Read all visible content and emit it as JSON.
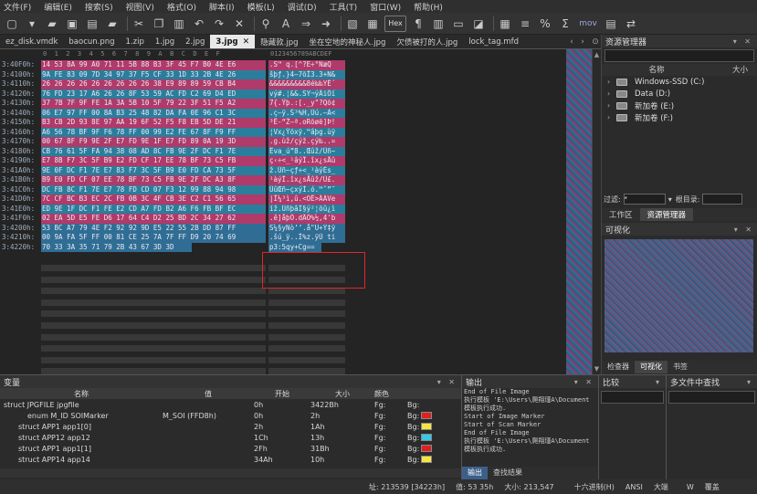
{
  "menu": [
    "文件(F)",
    "编辑(E)",
    "搜索(S)",
    "视图(V)",
    "格式(O)",
    "脚本(I)",
    "模板(L)",
    "调试(D)",
    "工具(T)",
    "窗口(W)",
    "帮助(H)"
  ],
  "toolbar": {
    "hex_label": "Hex",
    "mov_label": "mov"
  },
  "tabs": [
    {
      "label": "ez_disk.vmdk",
      "active": false
    },
    {
      "label": "baocun.png",
      "active": false
    },
    {
      "label": "1.zip",
      "active": false
    },
    {
      "label": "1.jpg",
      "active": false
    },
    {
      "label": "2.jpg",
      "active": false
    },
    {
      "label": "3.jpg",
      "active": true
    },
    {
      "label": "隐藏款.jpg",
      "active": false
    },
    {
      "label": "坐在空地的神秘人.jpg",
      "active": false
    },
    {
      "label": "欠债被打的人.jpg",
      "active": false
    },
    {
      "label": "lock_tag.mfd",
      "active": false
    }
  ],
  "ruler": {
    "hex": "0  1  2  3  4  5  6  7  8  9  A  B  C  D  E  F",
    "text": "0123456789ABCDEF"
  },
  "hex_rows": [
    {
      "addr": "3:40F0h:",
      "hex": "14 53 8A 99 A0 71 11 5B 88 B3 3F 45 F7 B0 4E E6",
      "text": ".S™ q.[^?E÷°NæQ"
    },
    {
      "addr": "3:4100h:",
      "hex": "9A FE 83 09 7D 34 97 37 F5 CF 33 1D 33 2B 4E 26",
      "text": "šþƒ.}4—7õÏ3.3+N&"
    },
    {
      "addr": "3:4110h:",
      "hex": "26 26 26 26 26 26 26 26 26 38 E9 89 89 59 CB B4",
      "text": "&&&&&&&&&8é‰‰YË´"
    },
    {
      "addr": "3:4120h:",
      "hex": "76 FD 23 17 A6 26 26 8F 53 59 AC FD C2 69 D4 ED",
      "text": "vý#.¦&&.SY¬ýÂiÔí"
    },
    {
      "addr": "3:4130h:",
      "hex": "37 7B 7F 9F FE 1A 3A 5B 10 5F 79 22 3F 51 F5 A2",
      "text": "7{.Ÿþ.:[._y\"?Qõ¢"
    },
    {
      "addr": "3:4140h:",
      "hex": "06 E7 97 FF 00 8A B3 25 48 82 DA FA 0E 96 C1 3C",
      "text": ".ç—ÿ.Š³%H‚Úú.–Á<"
    },
    {
      "addr": "3:4150h:",
      "hex": "B3 CB 2D 93 8E 97 AA 19 6F 52 F5 F8 EB 5D DE 21",
      "text": "³Ë-“Ž—ª.oRõøë]Þ!"
    },
    {
      "addr": "3:4160h:",
      "hex": "A6 56 78 BF 9F F6 78 FF 00 99 E2 FE 67 8F F9 FF",
      "text": "¦Vx¿Ÿöxÿ.™âþg.ùÿ"
    },
    {
      "addr": "3:4170h:",
      "hex": "00 67 8F F9 9E 2F E7 FD 9E 1F E7 FD 89 0A 19 3D",
      "text": ".g.ùž/çýž.çý‰..="
    },
    {
      "addr": "3:4180h:",
      "hex": "CB 76 61 5F FA 94 38 08 AD 8C FB 9E 2F DC F1 7E",
      "text": "Ëva_ú”8..Œûž/Üñ~"
    },
    {
      "addr": "3:4190h:",
      "hex": "E7 8B F7 3C 5F B9 E2 FD CF 17 EE 78 BF 73 C5 FB",
      "text": "ç‹÷<_¹âýÏ.îx¿sÅû"
    },
    {
      "addr": "3:41A0h:",
      "hex": "9E 0F DC F1 7E E7 83 F7 3C 5F B9 E0 FD CA 73 5F",
      "text": "ž.Üñ~çƒ÷<_¹àýÊs_"
    },
    {
      "addr": "3:41B0h:",
      "hex": "B9 E0 FD CF 07 EE 78 BF 73 C5 FB 9E 2F DC A3 8F",
      "text": "¹àýÏ.îx¿sÅûž/Ü£."
    },
    {
      "addr": "3:41C0h:",
      "hex": "DC FB 8C F1 7E E7 78 FD CD 07 F3 12 99 88 94 98",
      "text": "ÜûŒñ~çxýÍ.ó.™ˆ”˜"
    },
    {
      "addr": "3:41D0h:",
      "hex": "7C CF BC B3 EC 2C FB 0B 3C 4F CB 3E C2 C1 56 65",
      "text": "|Ï¼³ì,û.<OË>ÂÁVe"
    },
    {
      "addr": "3:41E0h:",
      "hex": "ED 9E 1F DC F1 FE E2 CD A7 FD B2 A6 F6 FB BF EC",
      "text": "íž.ÜñþâÍ§ý²¦öû¿ì"
    },
    {
      "addr": "3:41F0h:",
      "hex": "02 EA 5D E5 FE D6 17 64 C4 D2 25 BD 2C 34 27 62",
      "text": ".ê]åþÖ.dÄÒ%½,4'b"
    },
    {
      "addr": "3:4200h:",
      "hex": "53 BC A7 79 4E F2 92 92 9D E5 22 55 2B DD 87 FF",
      "text": "S¼§yNò’’.å\"U+Ý‡ÿ"
    },
    {
      "addr": "3:4210h:",
      "hex": "00 9A FA 5F FF 00 81 CE 25 7A 7F FF D9 20 74 69",
      "text": ".šú_ÿ..Î%z.ÿÙ ti"
    },
    {
      "addr": "3:4220h:",
      "hex": "70 33 3A 35 71 79 2B 43 67 3D 3D",
      "text": "p3:5qy+Cg=="
    }
  ],
  "resource_manager": {
    "title": "资源管理器",
    "col_name": "名称",
    "col_size": "大小",
    "drives": [
      "Windows-SSD (C:)",
      "Data (D:)",
      "新加卷 (E:)",
      "新加卷 (F:)"
    ],
    "filter_label": "过滤:",
    "filter_value": "*",
    "root_label": "根目录:"
  },
  "right_tabs": [
    "工作区",
    "资源管理器"
  ],
  "visual": {
    "title": "可视化",
    "tabs": [
      "检查器",
      "可视化",
      "书签"
    ]
  },
  "variables": {
    "title": "变量",
    "headers": [
      "名称",
      "值",
      "开始",
      "大小",
      "颜色"
    ],
    "rows": [
      {
        "name": "struct JPGFILE jpgfile",
        "value": "",
        "start": "0h",
        "size": "3422Bh",
        "fg": "Fg:",
        "bg": "Bg:",
        "bgcolor": ""
      },
      {
        "name": "enum M_ID SOIMarker",
        "value": "M_SOI (FFD8h)",
        "start": "0h",
        "size": "2h",
        "fg": "Fg:",
        "bg": "Bg:",
        "bgcolor": "#e02020"
      },
      {
        "name": "struct APP1 app1[0]",
        "value": "",
        "start": "2h",
        "size": "1Ah",
        "fg": "Fg:",
        "bg": "Bg:",
        "bgcolor": "#f5e642"
      },
      {
        "name": "struct APP12 app12",
        "value": "",
        "start": "1Ch",
        "size": "13h",
        "fg": "Fg:",
        "bg": "Bg:",
        "bgcolor": "#35c8e8"
      },
      {
        "name": "struct APP1 app1[1]",
        "value": "",
        "start": "2Fh",
        "size": "31Bh",
        "fg": "Fg:",
        "bg": "Bg:",
        "bgcolor": "#e02020"
      },
      {
        "name": "struct APP14 app14",
        "value": "",
        "start": "34Ah",
        "size": "10h",
        "fg": "Fg:",
        "bg": "Bg:",
        "bgcolor": "#f5e642"
      }
    ]
  },
  "output": {
    "title": "输出",
    "text": "End of File Image\n执行模板 'E:\\Users\\爬翔瑾A\\Document\n模板执行成功.\nStart of Image Marker\nStart of Scan Marker\nEnd of File Image\n执行模板 'E:\\Users\\爬翔瑾A\\Document\n模板执行成功.",
    "tabs": [
      "输出",
      "查找结果"
    ]
  },
  "compare": {
    "title": "比较"
  },
  "find": {
    "title": "多文件中查找"
  },
  "status": {
    "address": "址: 213539 [34223h]",
    "value": "值: 53 35h",
    "size": "大小: 213,547",
    "base": "十六进制(H)",
    "encoding": "ANSI",
    "endian": "大端",
    "mode": "W",
    "overwrite": "覆盖"
  }
}
